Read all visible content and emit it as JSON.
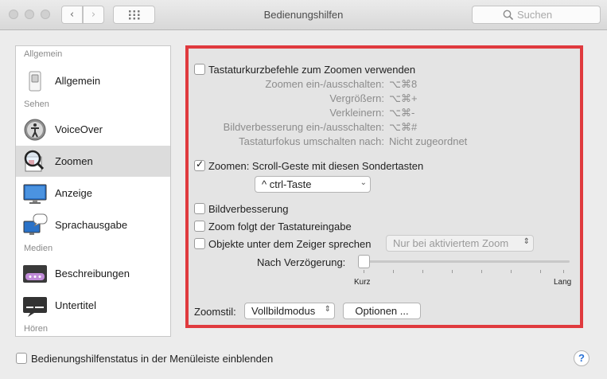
{
  "window": {
    "title": "Bedienungshilfen",
    "search_placeholder": "Suchen",
    "nav_back": "‹",
    "nav_forward": "›"
  },
  "sidebar": {
    "categories": [
      "Allgemein",
      "Sehen",
      "Medien",
      "Hören"
    ],
    "items": [
      {
        "label": "Allgemein",
        "icon": "switch-icon"
      },
      {
        "label": "VoiceOver",
        "icon": "voiceover-icon"
      },
      {
        "label": "Zoomen",
        "icon": "zoom-icon",
        "selected": true
      },
      {
        "label": "Anzeige",
        "icon": "display-icon"
      },
      {
        "label": "Sprachausgabe",
        "icon": "speech-icon"
      },
      {
        "label": "Beschreibungen",
        "icon": "descriptions-icon"
      },
      {
        "label": "Untertitel",
        "icon": "captions-icon"
      }
    ]
  },
  "zoom": {
    "shortcuts_checkbox": "Tastaturkurzbefehle zum Zoomen verwenden",
    "shortcuts_checked": false,
    "shortcuts": [
      {
        "label": "Zoomen ein-/ausschalten:",
        "keys": "⌥⌘8"
      },
      {
        "label": "Vergrößern:",
        "keys": "⌥⌘+"
      },
      {
        "label": "Verkleinern:",
        "keys": "⌥⌘-"
      },
      {
        "label": "Bildverbesserung ein-/ausschalten:",
        "keys": "⌥⌘#"
      },
      {
        "label": "Tastaturfokus umschalten nach:",
        "keys": "Nicht zugeordnet"
      }
    ],
    "scroll_checkbox": "Zoomen: Scroll-Geste mit diesen Sondertasten",
    "scroll_checked": true,
    "modifier_popup": "^ ctrl-Taste",
    "smoothing_checkbox": "Bildverbesserung",
    "smoothing_checked": false,
    "follow_focus_checkbox": "Zoom folgt der Tastatureingabe",
    "follow_focus_checked": false,
    "speak_checkbox": "Objekte unter dem Zeiger sprechen",
    "speak_checked": false,
    "speak_popup": "Nur bei aktiviertem Zoom",
    "delay_label": "Nach Verzögerung:",
    "delay_min": "Kurz",
    "delay_max": "Lang",
    "delay_value": 0,
    "style_label": "Zoomstil:",
    "style_popup": "Vollbildmodus",
    "options_button": "Optionen ..."
  },
  "footer": {
    "menubar_checkbox": "Bedienungshilfenstatus in der Menüleiste einblenden",
    "menubar_checked": false,
    "help": "?"
  },
  "colors": {
    "highlight_border": "#e03a3e",
    "selection": "#dcdcdc"
  }
}
